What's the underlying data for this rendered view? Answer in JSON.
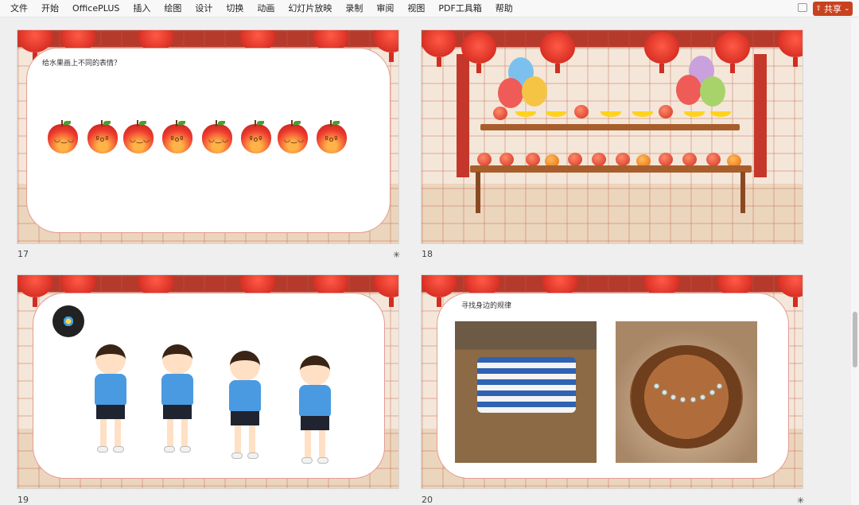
{
  "menu": {
    "items": [
      "文件",
      "开始",
      "OfficePLUS",
      "插入",
      "绘图",
      "设计",
      "切换",
      "动画",
      "幻灯片放映",
      "录制",
      "审阅",
      "视图",
      "PDF工具箱",
      "帮助"
    ]
  },
  "share_button": {
    "label": "共享",
    "icon": "share-icon",
    "dropdown": "⌄"
  },
  "colors": {
    "accent": "#c8421f"
  },
  "slides": [
    {
      "number": "17",
      "title": "给水果画上不同的表情？",
      "marker": "✳"
    },
    {
      "number": "18"
    },
    {
      "number": "19"
    },
    {
      "number": "20",
      "title": "寻找身边的规律",
      "marker": "✳"
    }
  ]
}
